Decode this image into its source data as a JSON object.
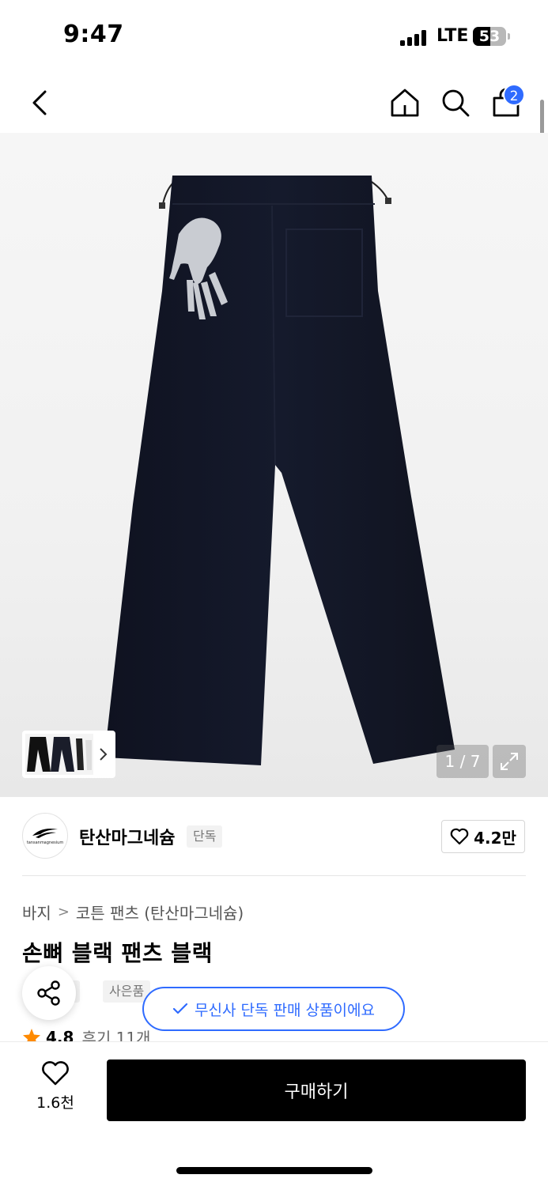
{
  "status_bar": {
    "time": "9:47",
    "network": "LTE",
    "battery": "53",
    "battery_level": 0.53
  },
  "header": {
    "cart_count": "2",
    "icons": [
      "back-arrow-icon",
      "home-icon",
      "search-icon",
      "shopping-bag-icon"
    ]
  },
  "gallery": {
    "counter": "1 / 7",
    "current": 1,
    "total": 7
  },
  "brand": {
    "name": "탄산마그네슘",
    "tag": "단독",
    "likes": "4.2만",
    "logo_text": "tansanmagnesium"
  },
  "breadcrumb": {
    "category": "바지",
    "subcategory": "코튼 팬츠 (탄산마그네슘)"
  },
  "product": {
    "title": "손뼈 블랙 팬츠 블랙",
    "tags": [
      "단독",
      "사은품"
    ],
    "rating": "4.8",
    "reviews": "후기 11개"
  },
  "banner": {
    "text": "무신사 단독 판매 상품이에요"
  },
  "bottom_bar": {
    "wish_count": "1.6천",
    "buy_label": "구매하기"
  },
  "colors": {
    "accent": "#2f6bff",
    "buy_button": "#000000",
    "star": "#ff8a00"
  }
}
